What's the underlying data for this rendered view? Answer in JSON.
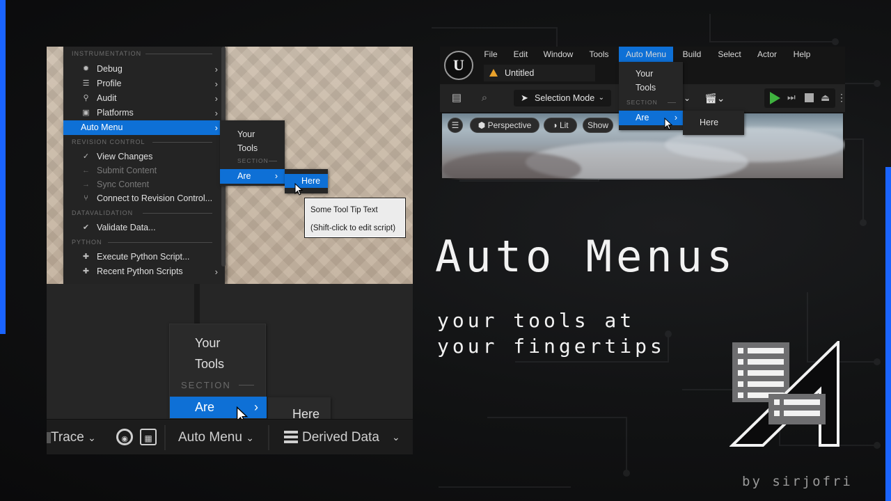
{
  "colors": {
    "accent": "#1a64ff",
    "selection": "#0e70d6",
    "play": "#3fb23f",
    "warning": "#e9a12b"
  },
  "left_editor_menu": {
    "sections": [
      {
        "label": "INSTRUMENTATION"
      },
      {
        "label": "REVISION CONTROL"
      },
      {
        "label": "DATAVALIDATION"
      },
      {
        "label": "PYTHON"
      }
    ],
    "items": [
      {
        "label": "Debug",
        "icon": "bug-icon"
      },
      {
        "label": "Profile",
        "icon": "profile-icon"
      },
      {
        "label": "Audit",
        "icon": "audit-icon"
      },
      {
        "label": "Platforms",
        "icon": "platforms-icon"
      },
      {
        "label": "Auto Menu"
      },
      {
        "label": "View Changes",
        "icon": "check-circle-icon"
      },
      {
        "label": "Submit Content",
        "icon": "arrow-left-icon"
      },
      {
        "label": "Sync Content",
        "icon": "arrow-right-icon"
      },
      {
        "label": "Connect to Revision Control...",
        "icon": "branch-icon"
      },
      {
        "label": "Validate Data...",
        "icon": "validate-icon"
      },
      {
        "label": "Execute Python Script...",
        "icon": "python-icon"
      },
      {
        "label": "Recent Python Scripts",
        "icon": "python-icon"
      }
    ]
  },
  "submenu": {
    "your": "Your",
    "tools": "Tools",
    "section": "SECTION",
    "are": "Are",
    "here": "Here"
  },
  "tooltip": {
    "line1": "Some Tool Tip Text",
    "line2": "(Shift-click to edit script)"
  },
  "bottom_toolbar": {
    "trace": "Trace",
    "auto_menu": "Auto Menu",
    "derived_data": "Derived Data"
  },
  "ue_editor": {
    "menubar": [
      "File",
      "Edit",
      "Window",
      "Tools",
      "Auto Menu",
      "Build",
      "Select",
      "Actor",
      "Help"
    ],
    "tab_title": "Untitled",
    "selection_mode": "Selection Mode",
    "viewport_buttons": {
      "perspective": "Perspective",
      "lit": "Lit",
      "show": "Show"
    }
  },
  "hero": {
    "title": "Auto Menus",
    "tagline_1": "your tools at",
    "tagline_2": "your fingertips",
    "byline": "by sirjofri"
  }
}
